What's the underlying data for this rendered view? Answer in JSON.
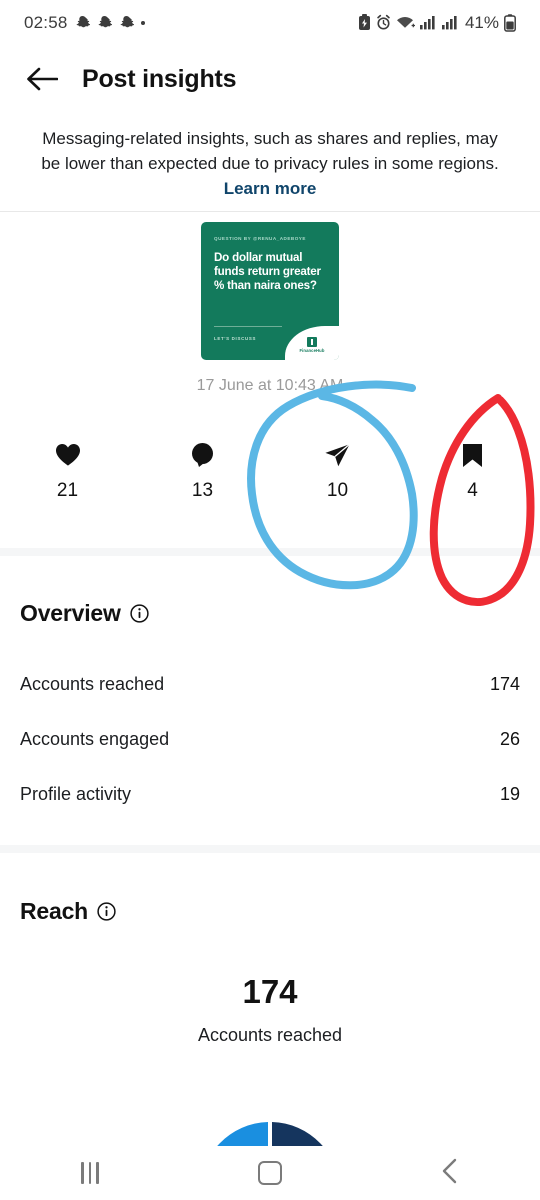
{
  "status_bar": {
    "time": "02:58",
    "battery_percent": "41%",
    "icons": [
      "snapchat-ghost-icon",
      "snapchat-ghost-icon",
      "snapchat-ghost-icon",
      "dot-icon",
      "battery-saver-icon",
      "alarm-icon",
      "wifi-icon",
      "signal-icon",
      "signal-icon",
      "battery-icon"
    ]
  },
  "header": {
    "title": "Post insights",
    "back_icon": "back-arrow-icon"
  },
  "banner": {
    "text": "Messaging-related insights, such as shares and replies, may be lower than expected due to privacy rules in some regions. ",
    "link": "Learn more",
    "link_color": "#10456b"
  },
  "post": {
    "thumbnail": {
      "background_color": "#137a5c",
      "kicker": "QUESTION BY @RENUA_ADEBOYE",
      "question": "Do dollar mutual funds return greater % than naira ones?",
      "cta": "LET'S DISCUSS",
      "badge_text": "FinanceHub"
    },
    "date": "17 June at 10:43 AM"
  },
  "metrics": [
    {
      "icon": "heart-icon",
      "name": "likes",
      "value": "21"
    },
    {
      "icon": "comment-icon",
      "name": "comments",
      "value": "13"
    },
    {
      "icon": "share-icon",
      "name": "shares",
      "value": "10"
    },
    {
      "icon": "bookmark-icon",
      "name": "saves",
      "value": "4"
    }
  ],
  "overview": {
    "title": "Overview",
    "info_icon": "info-icon",
    "rows": [
      {
        "label": "Accounts reached",
        "value": "174"
      },
      {
        "label": "Accounts engaged",
        "value": "26"
      },
      {
        "label": "Profile activity",
        "value": "19"
      }
    ]
  },
  "reach": {
    "title": "Reach",
    "info_icon": "info-icon",
    "value": "174",
    "label": "Accounts reached"
  },
  "annotations": [
    {
      "name": "blue-circle-annotation",
      "color": "#5bb7e5",
      "target": "shares-metric"
    },
    {
      "name": "red-circle-annotation",
      "color": "#ee2b33",
      "target": "saves-metric"
    }
  ],
  "nav_bar": {
    "recents_label": "recents-button",
    "home_label": "home-button",
    "back_label": "back-button"
  },
  "chart_data": {
    "type": "pie",
    "title": "",
    "note": "Partially visible donut/arc chart cut off at bottom of viewport",
    "series": [
      {
        "name": "segment-1",
        "color": "#1a8fe0",
        "value": 50
      },
      {
        "name": "segment-2",
        "color": "#15355e",
        "value": 50
      }
    ]
  }
}
